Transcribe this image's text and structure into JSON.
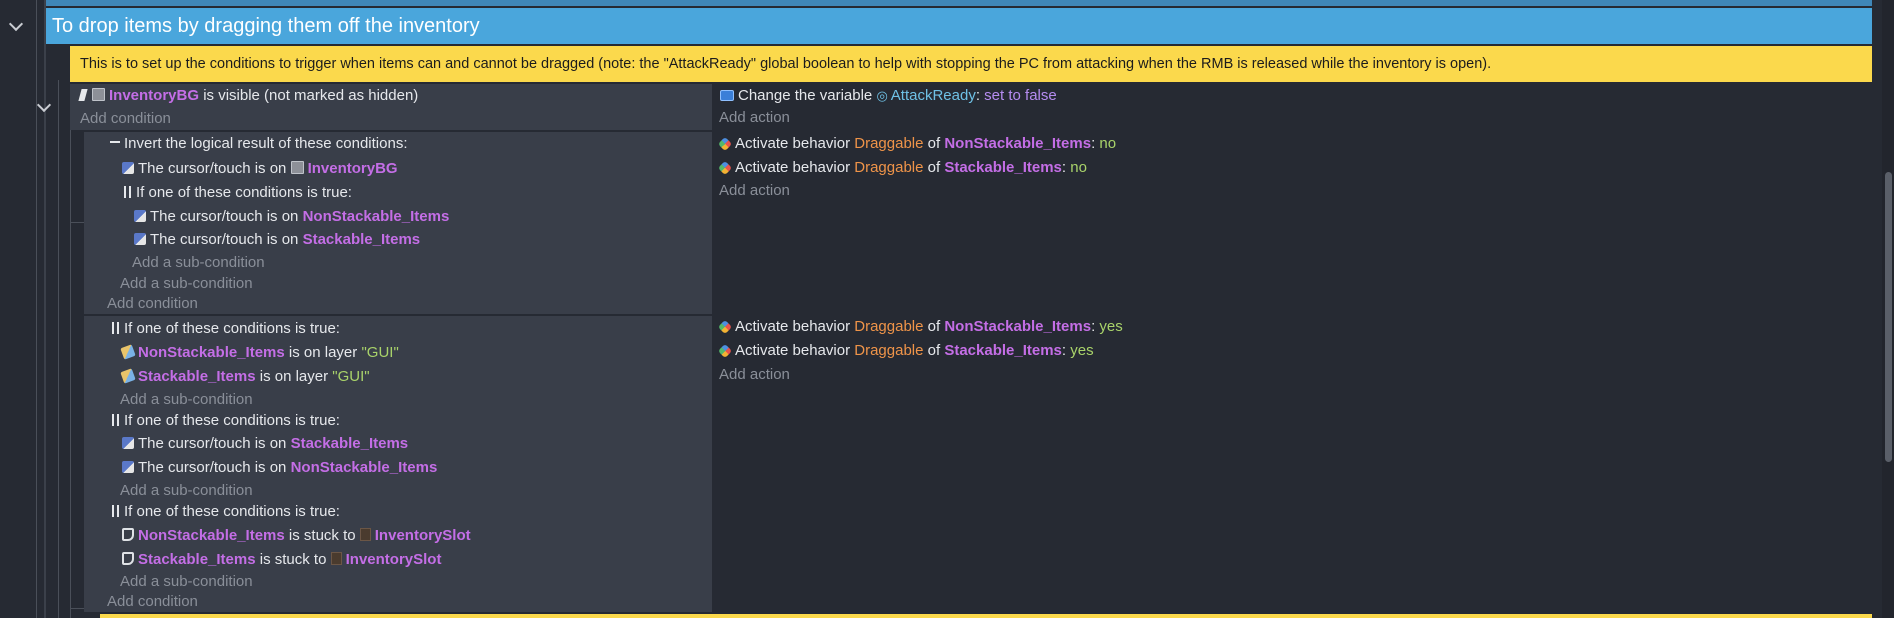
{
  "group": {
    "title": "To drop items by dragging them off the inventory"
  },
  "comment": {
    "text": "This is to set up the conditions to trigger when items can and cannot be dragged (note: the \"AttackReady\" global boolean to help with stopping the PC from attacking when the RMB is released while the inventory is open)."
  },
  "labels": {
    "add_condition": "Add condition",
    "add_action": "Add action",
    "add_sub_condition": "Add a sub-condition",
    "invert": "Invert the logical result of these conditions:",
    "or": "If one of these conditions is true:",
    "cursor_on": "The cursor/touch is on",
    "on_layer": "is on layer",
    "stuck_to": "is stuck to",
    "is_visible": "is visible (not marked as hidden)",
    "change_var": "Change the variable",
    "set_false": "set to false",
    "activate": "Activate behavior",
    "of": "of"
  },
  "objects": {
    "inventory_bg": "InventoryBG",
    "nonstack": "NonStackable_Items",
    "stack": "Stackable_Items",
    "slot": "InventorySlot",
    "draggable": "Draggable",
    "attack_ready": "AttackReady"
  },
  "values": {
    "no": "no",
    "yes": "yes",
    "layer_gui": "\"GUI\""
  },
  "colors": {
    "group_header": "#4aa6dc",
    "comment_bg": "#fbd94c",
    "object_name": "#c46ee6",
    "behavior_name": "#ef9449",
    "value": "#a9d36a"
  },
  "icons": [
    "chevron-down-icon",
    "object-icon",
    "cursor-icon",
    "layer-icon",
    "behavior-icon",
    "variable-icon",
    "global-variable-icon",
    "stuck-icon",
    "slot-icon",
    "invert-icon",
    "or-icon",
    "not-icon"
  ]
}
